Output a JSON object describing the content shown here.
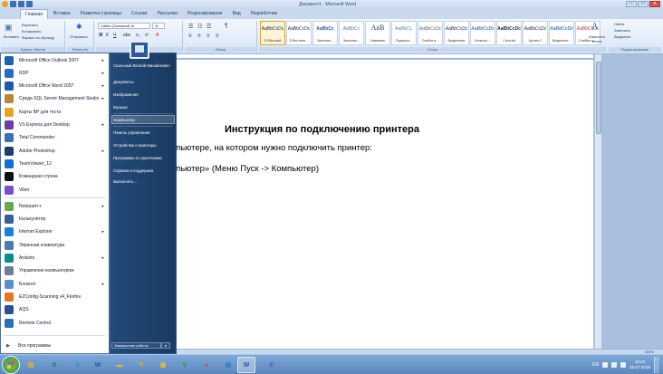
{
  "window": {
    "title": "Документ1 - Microsoft Word",
    "buttons": {
      "minimize": "–",
      "maximize": "□",
      "close": "✕"
    }
  },
  "ribbon": {
    "tabs": [
      "Главная",
      "Вставка",
      "Разметка страницы",
      "Ссылки",
      "Рассылки",
      "Рецензирование",
      "Вид",
      "Разработчик"
    ],
    "active_tab": "Главная",
    "clipboard": {
      "paste": "Вставить",
      "cut": "Вырезать",
      "copy": "Копировать",
      "format_painter": "Формат по образцу",
      "label": "Буфер обмена"
    },
    "bluetooth": {
      "label": "Bluetooth",
      "send": "Отправить"
    },
    "font": {
      "family": "Calibri (Основной те",
      "size": "11",
      "label": "Шрифт"
    },
    "paragraph": {
      "label": "Абзац"
    },
    "styles": {
      "label": "Стили",
      "items": [
        {
          "sample": "AaBbCcDc",
          "name": "¶ Обычный"
        },
        {
          "sample": "AaBbCcDc",
          "name": "¶ Без инте..."
        },
        {
          "sample": "AaBbCc",
          "name": "Заголово..."
        },
        {
          "sample": "AaBbCc",
          "name": "Заголово..."
        },
        {
          "sample": "AaB",
          "name": "Название"
        },
        {
          "sample": "AaBbCc.",
          "name": "Подзагол..."
        },
        {
          "sample": "AaBbCcDc",
          "name": "Слабое в..."
        },
        {
          "sample": "AaBbCcDc",
          "name": "Выделение"
        },
        {
          "sample": "AaBbCcDc",
          "name": "Сильное ..."
        },
        {
          "sample": "AaBbCcDc",
          "name": "Строгий"
        },
        {
          "sample": "AaBbCcDc",
          "name": "Цитата 2"
        },
        {
          "sample": "AaBbCcDc",
          "name": "Выделенн..."
        },
        {
          "sample": "AaBbCcDc",
          "name": "Слабая сс..."
        }
      ],
      "change_styles": "Изменить стили"
    },
    "editing": {
      "find": "Найти",
      "replace": "Заменить",
      "select": "Выделить",
      "label": "Редактирование"
    }
  },
  "document": {
    "title": "Инструкция по подключению принтера",
    "line1": "компьютере, на котором нужно подключить принтер:",
    "line2": "компьютер» (Меню Пуск -> Компьютер)"
  },
  "statusbar": {
    "zoom": "100%"
  },
  "start_menu": {
    "programs": [
      {
        "label": "Microsoft Office Outlook 2007",
        "icon": "outlook-icon",
        "color": "#1f5fb0",
        "arrow": true
      },
      {
        "label": "RDP",
        "icon": "rdp-icon",
        "color": "#2a6cc4",
        "arrow": true
      },
      {
        "label": "Microsoft Office Word 2007",
        "icon": "word-icon",
        "color": "#2457a8",
        "arrow": true
      },
      {
        "label": "Среда SQL Server Management Studio",
        "icon": "sql-server-icon",
        "color": "#b8863b",
        "arrow": true
      },
      {
        "label": "Карты ВР для теста",
        "icon": "maps-icon",
        "color": "#e0a72a",
        "arrow": false
      },
      {
        "label": "VS Express для Desktop",
        "icon": "visual-studio-icon",
        "color": "#6b3fa0",
        "arrow": true
      },
      {
        "label": "Total Commander",
        "icon": "total-commander-icon",
        "color": "#3e6fb5",
        "arrow": false
      },
      {
        "label": "Adobe Photoshop",
        "icon": "photoshop-icon",
        "color": "#1b3d66",
        "arrow": true
      },
      {
        "label": "TeamViewer_12",
        "icon": "teamviewer-icon",
        "color": "#0e6fd6",
        "arrow": false
      },
      {
        "label": "Командная строка",
        "icon": "command-prompt-icon",
        "color": "#111111",
        "arrow": false
      },
      {
        "label": "Viber",
        "icon": "viber-icon",
        "color": "#7b4fc9",
        "arrow": false
      },
      {
        "label": "Notepad++",
        "icon": "notepad-plus-plus-icon",
        "color": "#6aa84f",
        "arrow": true
      },
      {
        "label": "Калькулятор",
        "icon": "calculator-icon",
        "color": "#3b5f8e",
        "arrow": false
      },
      {
        "label": "Internet Explorer",
        "icon": "internet-explorer-icon",
        "color": "#1f7fd6",
        "arrow": true
      },
      {
        "label": "Экранная клавиатура",
        "icon": "keyboard-icon",
        "color": "#4a7ab0",
        "arrow": false
      },
      {
        "label": "Arduino",
        "icon": "arduino-icon",
        "color": "#0b8c8c",
        "arrow": true
      },
      {
        "label": "Управление компьютером",
        "icon": "computer-management-icon",
        "color": "#6b7f99",
        "arrow": false
      },
      {
        "label": "Блокнот",
        "icon": "notepad-icon",
        "color": "#5a8fc7",
        "arrow": true
      },
      {
        "label": "EZConfig-Scanning v4_Firefox",
        "icon": "ezconfig-icon",
        "color": "#e37529",
        "arrow": false
      },
      {
        "label": "AQS",
        "icon": "aqs-icon",
        "color": "#2b4f8c",
        "arrow": false
      },
      {
        "label": "Remote Control",
        "icon": "remote-control-icon",
        "color": "#2f6fb5",
        "arrow": false
      }
    ],
    "all_programs": "Все программы",
    "right_panel": {
      "user": "Скальный Віталій Михайлович",
      "items": [
        "Документы",
        "Изображения",
        "Музыка",
        "Компьютер",
        "Панель управления",
        "Устройства и принтеры",
        "Программы по умолчанию",
        "Справка и поддержка",
        "Выполнить..."
      ],
      "highlighted": "Компьютер",
      "shutdown": "Завершение работы"
    }
  },
  "taskbar": {
    "buttons": [
      {
        "icon": "windows-explorer-icon",
        "glyph": "▤",
        "color": "#e3b43a"
      },
      {
        "icon": "excel-icon",
        "glyph": "X",
        "color": "#1e7b3d"
      },
      {
        "icon": "skype-icon",
        "glyph": "S",
        "color": "#1e8ed6"
      },
      {
        "icon": "word-icon",
        "glyph": "W",
        "color": "#2457a8"
      },
      {
        "icon": "folder-icon",
        "glyph": "▬",
        "color": "#e5b54a"
      },
      {
        "icon": "paint-icon",
        "glyph": "✎",
        "color": "#e2a12c"
      },
      {
        "icon": "folder-icon",
        "glyph": "▣",
        "color": "#e5b54a"
      },
      {
        "icon": "vpn-icon",
        "glyph": "V",
        "color": "#2f8f4e"
      },
      {
        "icon": "chrome-icon",
        "glyph": "●",
        "color": "#d9433a"
      },
      {
        "icon": "remote-desktop-icon",
        "glyph": "▥",
        "color": "#3a7ac4"
      },
      {
        "icon": "word-icon",
        "glyph": "W",
        "color": "#2457a8"
      },
      {
        "icon": "viber-icon",
        "glyph": "✆",
        "color": "#7b4fc9"
      }
    ],
    "language": "EN",
    "time": "12:22",
    "date": "26.07.2018"
  }
}
